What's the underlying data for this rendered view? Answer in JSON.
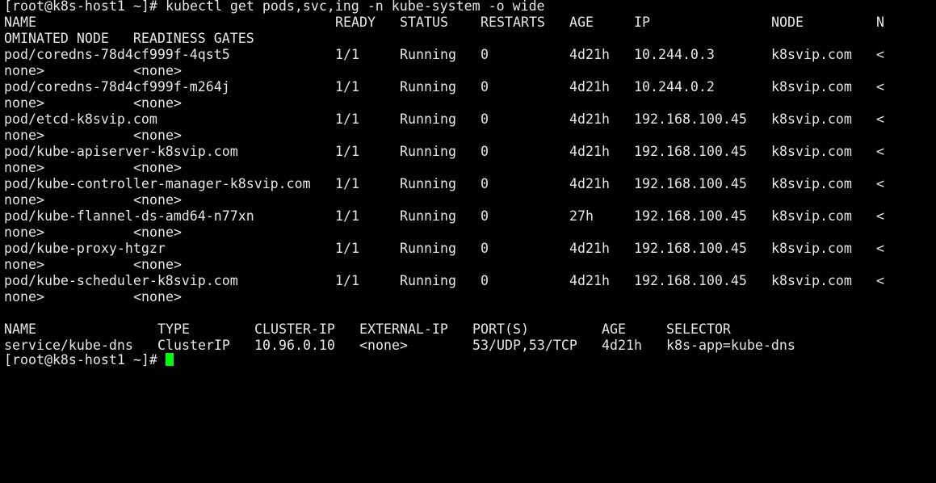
{
  "theme": {
    "background": "#000000",
    "foreground": "#e6e6e6",
    "cursor": "#00ff00"
  },
  "prompt": "[root@k8s-host1 ~]#",
  "command": "kubectl get pods,svc,ing -n kube-system -o wide",
  "pods_table": {
    "headers": [
      "NAME",
      "READY",
      "STATUS",
      "RESTARTS",
      "AGE",
      "IP",
      "NODE",
      "N"
    ],
    "wrapped_header": "OMINATED NODE   READINESS GATES",
    "rows": [
      {
        "name": "pod/coredns-78d4cf999f-4qst5",
        "ready": "1/1",
        "status": "Running",
        "restarts": "0",
        "age": "4d21h",
        "ip": "10.244.0.3",
        "node": "k8svip.com",
        "nominated_head": "<",
        "nominated_tail": "none>",
        "readiness": "<none>"
      },
      {
        "name": "pod/coredns-78d4cf999f-m264j",
        "ready": "1/1",
        "status": "Running",
        "restarts": "0",
        "age": "4d21h",
        "ip": "10.244.0.2",
        "node": "k8svip.com",
        "nominated_head": "<",
        "nominated_tail": "none>",
        "readiness": "<none>"
      },
      {
        "name": "pod/etcd-k8svip.com",
        "ready": "1/1",
        "status": "Running",
        "restarts": "0",
        "age": "4d21h",
        "ip": "192.168.100.45",
        "node": "k8svip.com",
        "nominated_head": "<",
        "nominated_tail": "none>",
        "readiness": "<none>"
      },
      {
        "name": "pod/kube-apiserver-k8svip.com",
        "ready": "1/1",
        "status": "Running",
        "restarts": "0",
        "age": "4d21h",
        "ip": "192.168.100.45",
        "node": "k8svip.com",
        "nominated_head": "<",
        "nominated_tail": "none>",
        "readiness": "<none>"
      },
      {
        "name": "pod/kube-controller-manager-k8svip.com",
        "ready": "1/1",
        "status": "Running",
        "restarts": "0",
        "age": "4d21h",
        "ip": "192.168.100.45",
        "node": "k8svip.com",
        "nominated_head": "<",
        "nominated_tail": "none>",
        "readiness": "<none>"
      },
      {
        "name": "pod/kube-flannel-ds-amd64-n77xn",
        "ready": "1/1",
        "status": "Running",
        "restarts": "0",
        "age": "27h",
        "ip": "192.168.100.45",
        "node": "k8svip.com",
        "nominated_head": "<",
        "nominated_tail": "none>",
        "readiness": "<none>"
      },
      {
        "name": "pod/kube-proxy-htgzr",
        "ready": "1/1",
        "status": "Running",
        "restarts": "0",
        "age": "4d21h",
        "ip": "192.168.100.45",
        "node": "k8svip.com",
        "nominated_head": "<",
        "nominated_tail": "none>",
        "readiness": "<none>"
      },
      {
        "name": "pod/kube-scheduler-k8svip.com",
        "ready": "1/1",
        "status": "Running",
        "restarts": "0",
        "age": "4d21h",
        "ip": "192.168.100.45",
        "node": "k8svip.com",
        "nominated_head": "<",
        "nominated_tail": "none>",
        "readiness": "<none>"
      }
    ]
  },
  "svc_table": {
    "headers": [
      "NAME",
      "TYPE",
      "CLUSTER-IP",
      "EXTERNAL-IP",
      "PORT(S)",
      "AGE",
      "SELECTOR"
    ],
    "rows": [
      {
        "name": "service/kube-dns",
        "type": "ClusterIP",
        "cluster_ip": "10.96.0.10",
        "external_ip": "<none>",
        "ports": "53/UDP,53/TCP",
        "age": "4d21h",
        "selector": "k8s-app=kube-dns"
      }
    ]
  },
  "final_prompt": "[root@k8s-host1 ~]#"
}
